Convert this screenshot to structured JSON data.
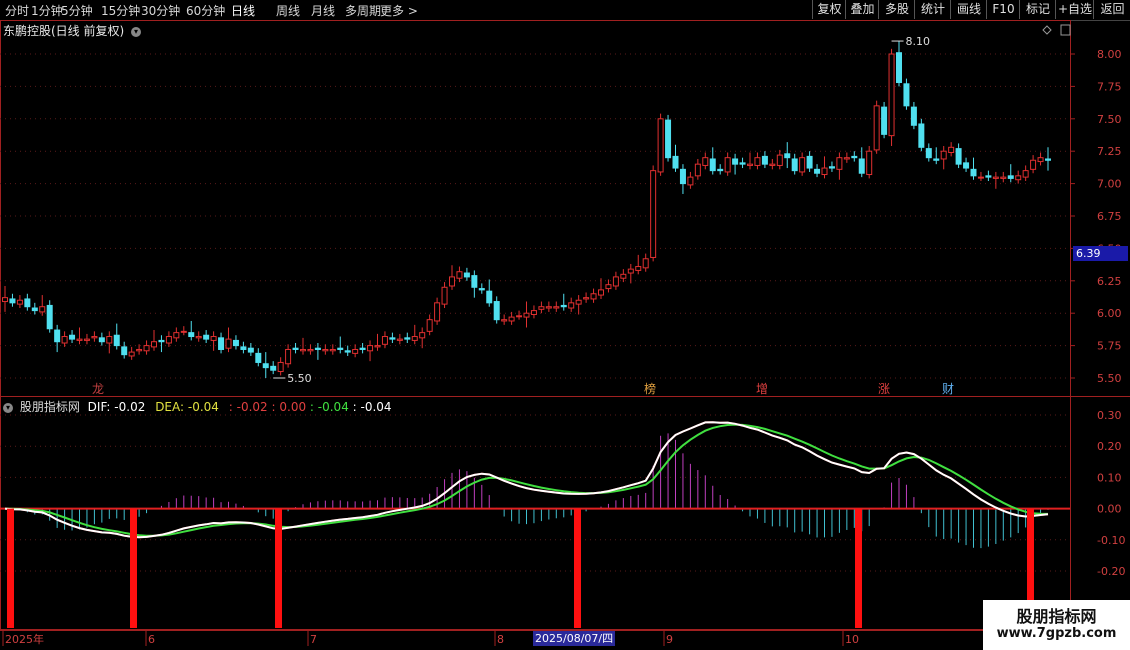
{
  "toolbar": {
    "periods": [
      "分时",
      "1分钟",
      "5分钟",
      "15分钟",
      "30分钟",
      "60分钟",
      "日线",
      "周线",
      "月线",
      "多周期",
      "更多 >"
    ],
    "active_period": "日线",
    "right": [
      "复权",
      "叠加",
      "多股",
      "统计",
      "画线",
      "F10",
      "标记",
      "+自选",
      "返回"
    ]
  },
  "stock": {
    "title": "东鹏控股(日线 前复权)",
    "price_high_label": "8.10",
    "price_low_label": "5.50",
    "current_price": "6.39"
  },
  "price_axis": [
    "8.00",
    "7.75",
    "7.50",
    "7.25",
    "7.00",
    "6.75",
    "6.50",
    "6.25",
    "6.00",
    "5.75",
    "5.50"
  ],
  "event_markers": [
    "龙",
    "榜",
    "增",
    "涨",
    "财"
  ],
  "indicator": {
    "name": "股朋指标网",
    "dif_label": "DIF:",
    "dif_value": "-0.02",
    "dea_label": "DEA:",
    "dea_value": "-0.04",
    "v3": ": -0.02",
    "v4": ": 0.00",
    "v5": ": -0.04",
    "v6": ": -0.04"
  },
  "indicator_axis": [
    "0.30",
    "0.20",
    "0.10",
    "0.00",
    "-0.10",
    "-0.20"
  ],
  "dates": [
    "2025年",
    "6",
    "7",
    "8",
    "9",
    "10"
  ],
  "date_highlight": "2025/08/07/四",
  "watermark": {
    "title": "股朋指标网",
    "url": "www.7gpzb.com"
  },
  "colors": {
    "up": "#e03030",
    "down": "#50e0f0",
    "dif": "#ffffff",
    "dea": "#40e040",
    "alt": "#e02020"
  },
  "chart_data": [
    {
      "type": "candlestick",
      "title": "东鹏控股(日线 前复权)",
      "ylim": [
        5.45,
        8.15
      ],
      "close": [
        6.12,
        6.08,
        6.1,
        6.05,
        6.02,
        6.05,
        5.88,
        5.78,
        5.82,
        5.8,
        5.8,
        5.8,
        5.82,
        5.78,
        5.82,
        5.75,
        5.68,
        5.7,
        5.72,
        5.75,
        5.78,
        5.78,
        5.82,
        5.85,
        5.86,
        5.82,
        5.82,
        5.8,
        5.82,
        5.72,
        5.8,
        5.75,
        5.72,
        5.7,
        5.62,
        5.58,
        5.56,
        5.62,
        5.72,
        5.72,
        5.72,
        5.72,
        5.72,
        5.72,
        5.72,
        5.72,
        5.7,
        5.72,
        5.72,
        5.75,
        5.75,
        5.82,
        5.8,
        5.8,
        5.8,
        5.82,
        5.85,
        5.95,
        6.08,
        6.2,
        6.28,
        6.32,
        6.28,
        6.2,
        6.18,
        6.08,
        5.95,
        5.95,
        5.97,
        5.98,
        6.0,
        6.02,
        6.05,
        6.05,
        6.05,
        6.05,
        6.08,
        6.1,
        6.12,
        6.15,
        6.18,
        6.22,
        6.28,
        6.3,
        6.34,
        6.36,
        6.42,
        7.1,
        7.5,
        7.2,
        7.12,
        7.0,
        7.05,
        7.15,
        7.2,
        7.1,
        7.1,
        7.2,
        7.15,
        7.15,
        7.15,
        7.2,
        7.15,
        7.15,
        7.22,
        7.2,
        7.1,
        7.2,
        7.12,
        7.08,
        7.12,
        7.12,
        7.2,
        7.2,
        7.2,
        7.08,
        7.25,
        7.6,
        7.38,
        8.0,
        7.78,
        7.6,
        7.45,
        7.28,
        7.2,
        7.18,
        7.25,
        7.28,
        7.15,
        7.12,
        7.06,
        7.05,
        7.05,
        7.05,
        7.05,
        7.04,
        7.06,
        7.1,
        7.18,
        7.2,
        7.18
      ],
      "macd": {
        "dif_last": -0.02,
        "dea_last": -0.04
      }
    }
  ]
}
